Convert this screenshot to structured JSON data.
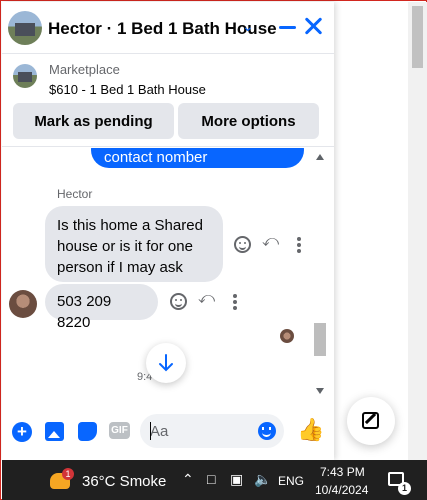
{
  "header": {
    "title": "Hector · 1 Bed 1 Bath House",
    "chevron": "chevron-down-icon",
    "minimize": "minimize-icon",
    "close": "close-icon"
  },
  "listing": {
    "label": "Marketplace",
    "price_title": "$610 - 1 Bed 1 Bath House",
    "mark_pending_label": "Mark as pending",
    "more_options_label": "More options"
  },
  "messages": {
    "outgoing_partial": "contact nomber",
    "sender_name": "Hector",
    "incoming": [
      "Is this home a Shared house or is it for one person if I may ask",
      "503 209 8220"
    ],
    "time": "9:4",
    "time_suffix": "4"
  },
  "composer": {
    "placeholder": "Aa"
  },
  "taskbar": {
    "weather_badge": "1",
    "weather": "36°C  Smoke",
    "lang": "ENG",
    "time": "7:43 PM",
    "date": "10/4/2024",
    "notif_badge": "1"
  },
  "colors": {
    "accent": "#0866ff",
    "bubble_in": "#e4e6eb",
    "taskbar": "#202020"
  }
}
